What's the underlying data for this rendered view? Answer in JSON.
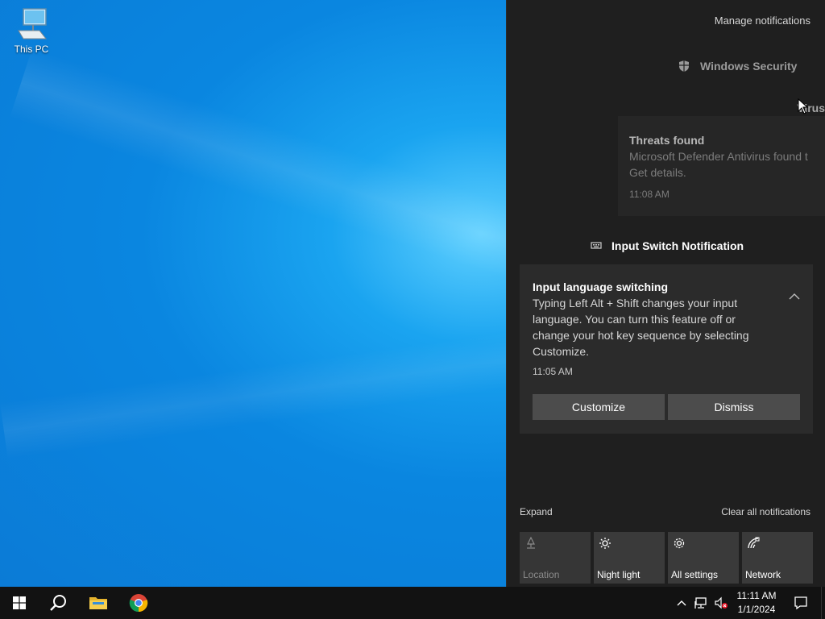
{
  "desktop": {
    "icons": [
      {
        "label": "This PC",
        "icon": "this-pc-icon"
      }
    ]
  },
  "action_center": {
    "manage_label": "Manage notifications",
    "groups": [
      {
        "app": "Windows Security",
        "icon": "shield-icon",
        "peek_text": "Virus",
        "toast": {
          "title": "Threats found",
          "body": "Microsoft Defender Antivirus found t\nGet details.",
          "time": "11:08 AM"
        }
      },
      {
        "app": "Input Switch Notification",
        "icon": "keyboard-icon",
        "toast": {
          "title": "Input language switching",
          "body": "Typing Left Alt + Shift changes your input language. You can turn this feature off or change your hot key sequence by selecting Customize.",
          "time": "11:05 AM",
          "buttons": [
            "Customize",
            "Dismiss"
          ]
        }
      }
    ],
    "expand_label": "Expand",
    "clear_all_label": "Clear all notifications",
    "quick_actions": [
      {
        "label": "Location",
        "icon": "location-icon",
        "enabled": false
      },
      {
        "label": "Night light",
        "icon": "night-light-icon",
        "enabled": true
      },
      {
        "label": "All settings",
        "icon": "gear-icon",
        "enabled": true
      },
      {
        "label": "Network",
        "icon": "network-icon",
        "enabled": true
      }
    ]
  },
  "taskbar": {
    "apps": [
      {
        "name": "Start",
        "icon": "windows-start-icon"
      },
      {
        "name": "Search",
        "icon": "search-icon"
      },
      {
        "name": "File Explorer",
        "icon": "folder-icon"
      },
      {
        "name": "Google Chrome",
        "icon": "chrome-icon"
      }
    ],
    "tray_icons": [
      "chevron-up-icon",
      "network-icon",
      "volume-muted-icon"
    ],
    "time": "11:11 AM",
    "date": "1/1/2024",
    "action_center_icon": "notification-icon"
  }
}
